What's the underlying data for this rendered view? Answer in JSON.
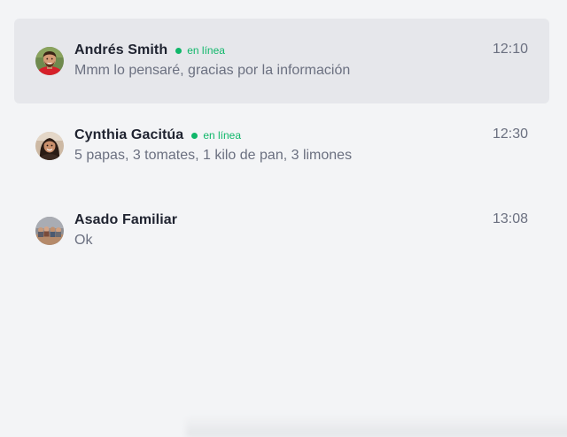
{
  "chats": [
    {
      "name": "Andrés Smith",
      "online": true,
      "status_label": "en línea",
      "preview": "Mmm lo pensaré, gracias por la información",
      "time": "12:10",
      "selected": true,
      "avatar": "avatar-andres"
    },
    {
      "name": "Cynthia Gacitúa",
      "online": true,
      "status_label": "en línea",
      "preview": "5 papas, 3 tomates, 1 kilo de pan, 3 limones",
      "time": "12:30",
      "selected": false,
      "avatar": "avatar-cynthia"
    },
    {
      "name": "Asado Familiar",
      "online": false,
      "status_label": "",
      "preview": "Ok",
      "time": "13:08",
      "selected": false,
      "avatar": "avatar-group"
    }
  ],
  "colors": {
    "background": "#f3f4f6",
    "selected_row": "#e6e7eb",
    "online": "#10b76a",
    "name": "#1f2330",
    "muted": "#6b7080"
  }
}
